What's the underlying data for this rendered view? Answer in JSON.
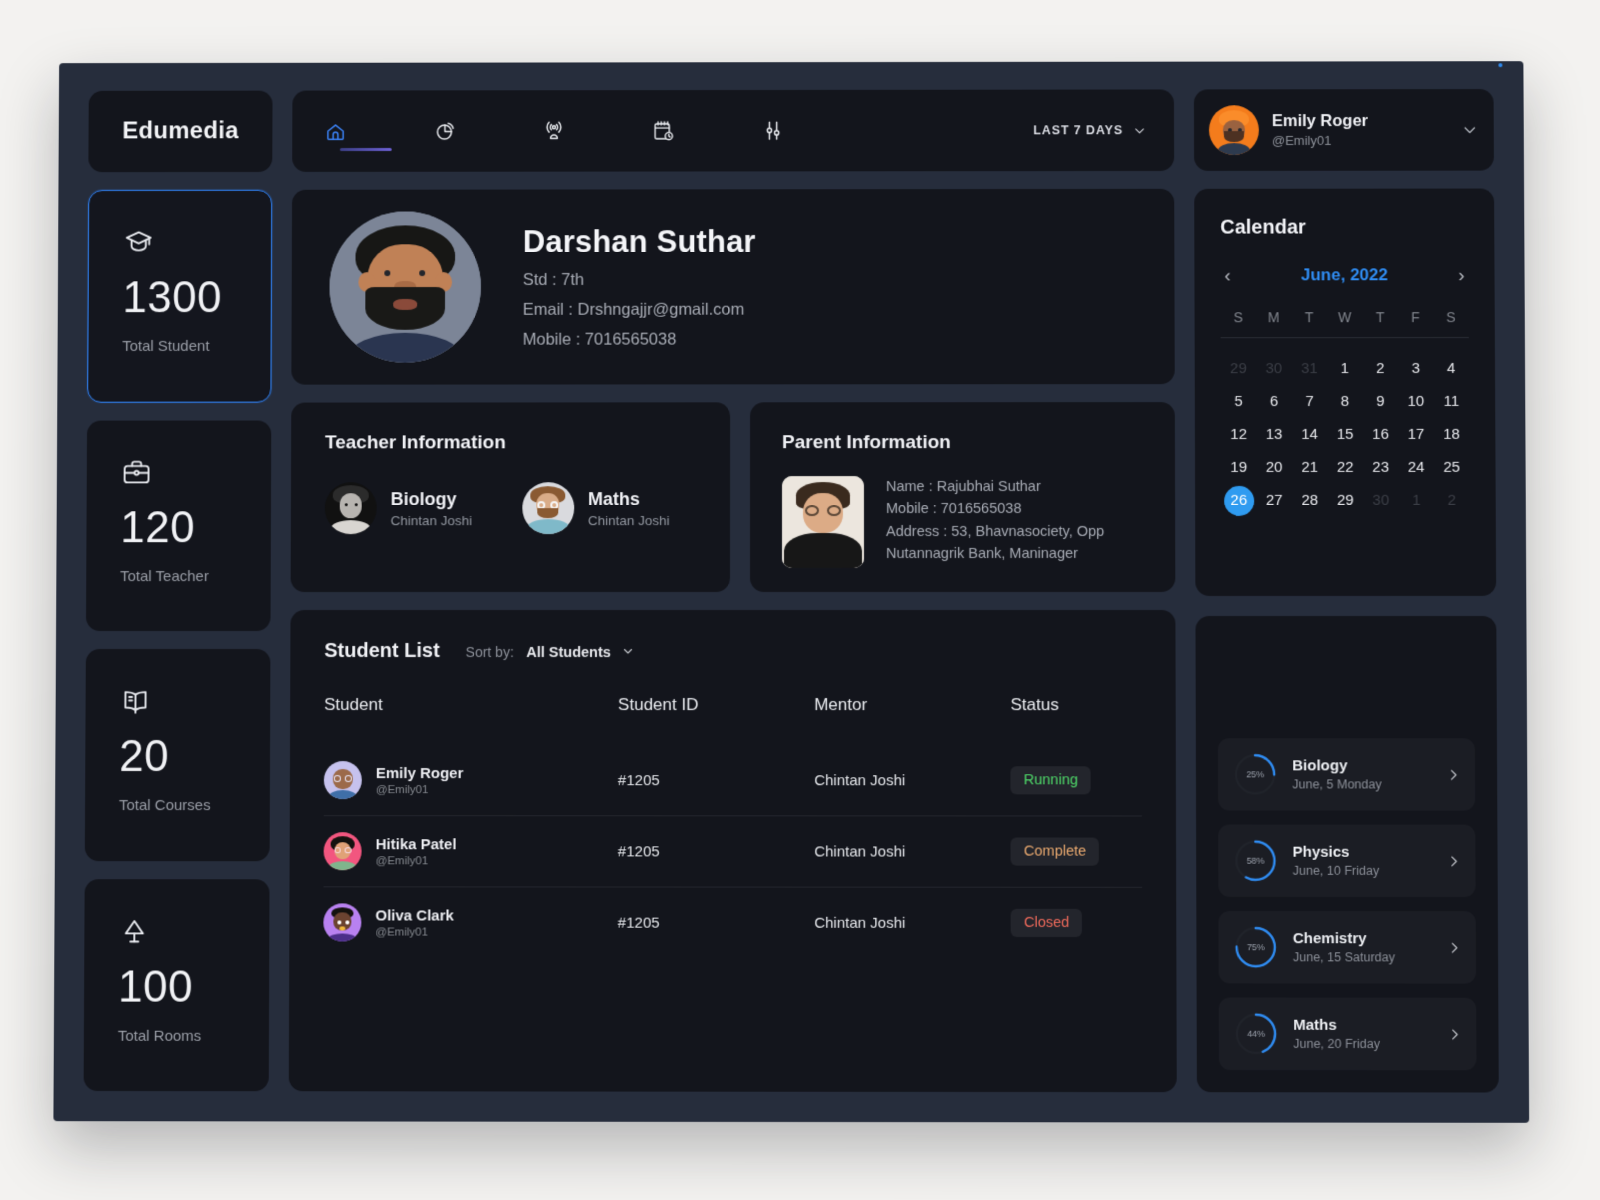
{
  "brand": {
    "name": "Edumedia"
  },
  "topnav": {
    "icons": [
      {
        "name": "home-icon",
        "active": true
      },
      {
        "name": "pie-chart-icon",
        "active": false
      },
      {
        "name": "broadcast-icon",
        "active": false
      },
      {
        "name": "calendar-clock-icon",
        "active": false
      },
      {
        "name": "sliders-icon",
        "active": false
      }
    ],
    "range_label": "LAST 7 DAYS"
  },
  "user": {
    "name": "Emily Roger",
    "handle": "@Emily01"
  },
  "stats": [
    {
      "icon": "graduation-cap-icon",
      "value": "1300",
      "label": "Total Student",
      "active": true
    },
    {
      "icon": "briefcase-icon",
      "value": "120",
      "label": "Total Teacher",
      "active": false
    },
    {
      "icon": "book-icon",
      "value": "20",
      "label": "Total Courses",
      "active": false
    },
    {
      "icon": "lamp-icon",
      "value": "100",
      "label": "Total Rooms",
      "active": false
    }
  ],
  "profile": {
    "name": "Darshan Suthar",
    "std": "Std : 7th",
    "email": "Email : Drshngajjr@gmail.com",
    "mobile": "Mobile : 7016565038"
  },
  "teacher_info": {
    "title": "Teacher Information",
    "teachers": [
      {
        "subject": "Biology",
        "name": "Chintan Joshi"
      },
      {
        "subject": "Maths",
        "name": "Chintan Joshi"
      }
    ]
  },
  "parent_info": {
    "title": "Parent Information",
    "lines": [
      "Name : Rajubhai Suthar",
      "Mobile : 7016565038",
      "Address : 53, Bhavnasociety, Opp",
      "Nutannagrik Bank, Maninager"
    ]
  },
  "student_list": {
    "title": "Student List",
    "sort_label": "Sort by:",
    "sort_value": "All Students",
    "columns": [
      "Student",
      "Student  ID",
      "Mentor",
      "Status"
    ],
    "rows": [
      {
        "name": "Emily Roger",
        "handle": "@Emily01",
        "id": "#1205",
        "mentor": "Chintan Joshi",
        "status": "Running",
        "status_color": "#4ed768",
        "avatar_bg": "#c6c2ee"
      },
      {
        "name": "Hitika Patel",
        "handle": "@Emily01",
        "id": "#1205",
        "mentor": "Chintan Joshi",
        "status": "Complete",
        "status_color": "#e9a96f",
        "avatar_bg": "#f2567f"
      },
      {
        "name": "Oliva Clark",
        "handle": "@Emily01",
        "id": "#1205",
        "mentor": "Chintan Joshi",
        "status": "Closed",
        "status_color": "#ef6a5b",
        "avatar_bg": "#b881f0"
      }
    ]
  },
  "calendar": {
    "title": "Calendar",
    "month": "June, 2022",
    "prev_icon": "chevron-left-icon",
    "next_icon": "chevron-right-icon",
    "dow": [
      "S",
      "M",
      "T",
      "W",
      "T",
      "F",
      "S"
    ],
    "weeks": [
      [
        {
          "d": "29",
          "mute": true
        },
        {
          "d": "30",
          "mute": true
        },
        {
          "d": "31",
          "mute": true
        },
        {
          "d": "1"
        },
        {
          "d": "2"
        },
        {
          "d": "3"
        },
        {
          "d": "4"
        }
      ],
      [
        {
          "d": "5"
        },
        {
          "d": "6"
        },
        {
          "d": "7"
        },
        {
          "d": "8"
        },
        {
          "d": "9"
        },
        {
          "d": "10"
        },
        {
          "d": "11"
        }
      ],
      [
        {
          "d": "12"
        },
        {
          "d": "13"
        },
        {
          "d": "14"
        },
        {
          "d": "15"
        },
        {
          "d": "16"
        },
        {
          "d": "17"
        },
        {
          "d": "18"
        }
      ],
      [
        {
          "d": "19"
        },
        {
          "d": "20"
        },
        {
          "d": "21"
        },
        {
          "d": "22"
        },
        {
          "d": "23"
        },
        {
          "d": "24"
        },
        {
          "d": "25"
        }
      ],
      [
        {
          "d": "26",
          "today": true
        },
        {
          "d": "27"
        },
        {
          "d": "28"
        },
        {
          "d": "29"
        },
        {
          "d": "30",
          "mute": true
        },
        {
          "d": "1",
          "mute": true
        },
        {
          "d": "2",
          "mute": true
        }
      ]
    ],
    "today_color": "#2f9bf0"
  },
  "subjects": [
    {
      "name": "Biology",
      "date": "June, 5 Monday",
      "percent": 25,
      "percent_label": "25%"
    },
    {
      "name": "Physics",
      "date": "June, 10 Friday",
      "percent": 58,
      "percent_label": "58%"
    },
    {
      "name": "Chemistry",
      "date": "June, 15 Saturday",
      "percent": 75,
      "percent_label": "75%"
    },
    {
      "name": "Maths",
      "date": "June, 20 Friday",
      "percent": 44,
      "percent_label": "44%"
    }
  ],
  "colors": {
    "page_bg": "#f3f2f0",
    "dashboard_bg": "#262d3c",
    "card_bg": "#13151c",
    "accent_blue": "#2f8bf0",
    "nav_active": "#5b57c9"
  }
}
